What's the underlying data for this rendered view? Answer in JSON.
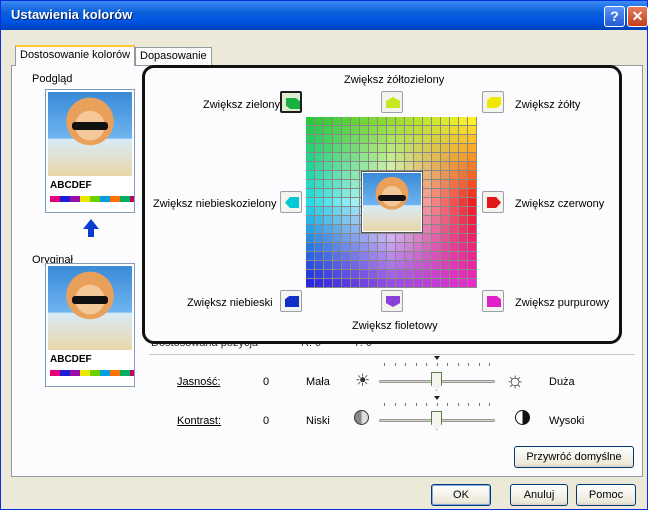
{
  "window": {
    "title": "Ustawienia kolorów",
    "help_glyph": "?",
    "close_glyph": "✕"
  },
  "tabs": [
    {
      "label": "Dostosowanie kolorów"
    },
    {
      "label": "Dopasowanie"
    }
  ],
  "preview": {
    "label": "Podgląd",
    "original_label": "Oryginał",
    "sample_text": "ABCDEF",
    "swatch_colors": [
      "#e6007e",
      "#1d1dd4",
      "#9a0ea8",
      "#e8e800",
      "#6ad000",
      "#00a0e0",
      "#ff7200",
      "#00b060",
      "#c00060"
    ]
  },
  "color_buttons": {
    "yellow_green": "Zwiększ żółtozielony",
    "green": "Zwiększ zielony",
    "yellow": "Zwiększ żółty",
    "cyan": "Zwiększ niebieskozielony",
    "red": "Zwiększ czerwony",
    "blue": "Zwiększ niebieski",
    "violet": "Zwiększ fioletowy",
    "magenta": "Zwiększ purpurowy"
  },
  "icon_colors": {
    "green": "#18b040",
    "yellow_green": "#c8e820",
    "yellow": "#f0e800",
    "cyan": "#00c8d8",
    "red": "#e01818",
    "blue": "#1030c8",
    "violet": "#8840d8",
    "magenta": "#e020c8"
  },
  "hidden_row": {
    "label": "Dostosowana pozycja",
    "r": "R: 0",
    "g": "Y: 0"
  },
  "brightness": {
    "label": "Jasność:",
    "value": "0",
    "low": "Mała",
    "high": "Duża",
    "level": 0.5
  },
  "contrast": {
    "label": "Kontrast:",
    "value": "0",
    "low": "Niski",
    "high": "Wysoki",
    "level": 0.5
  },
  "buttons": {
    "restore_defaults": "Przywróć domyślne",
    "ok": "OK",
    "cancel": "Anuluj",
    "help": "Pomoc"
  }
}
